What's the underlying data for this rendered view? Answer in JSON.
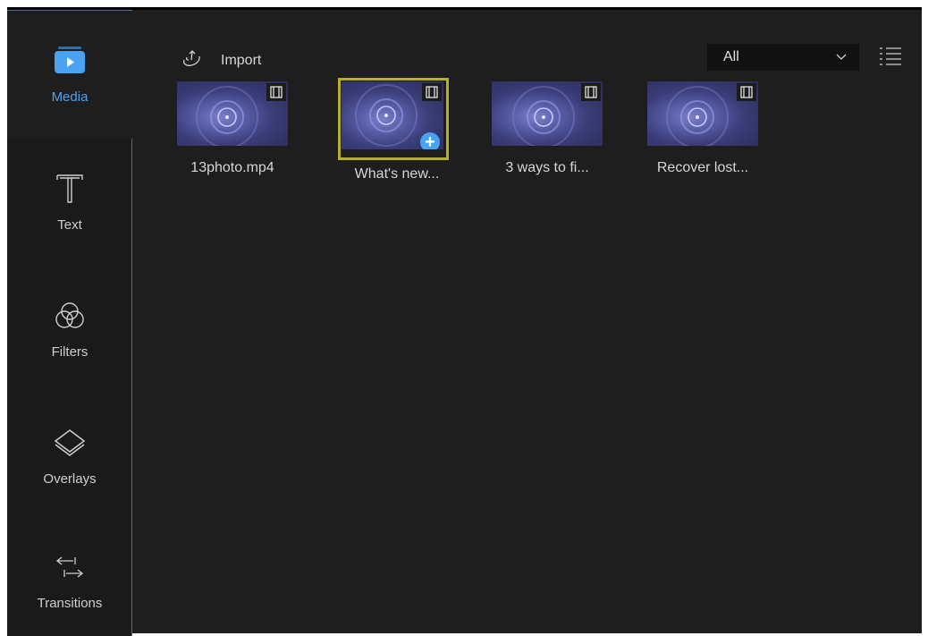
{
  "sidebar": {
    "items": [
      {
        "label": "Media",
        "icon": "play-media-icon"
      },
      {
        "label": "Text",
        "icon": "text-t-icon"
      },
      {
        "label": "Filters",
        "icon": "filters-circles-icon"
      },
      {
        "label": "Overlays",
        "icon": "overlays-layers-icon"
      },
      {
        "label": "Transitions",
        "icon": "transitions-arrows-icon"
      }
    ]
  },
  "toolbar": {
    "import_label": "Import",
    "filter_value": "All"
  },
  "media": {
    "items": [
      {
        "label": "13photo.mp4"
      },
      {
        "label": "What's new..."
      },
      {
        "label": "3 ways to fi..."
      },
      {
        "label": "Recover lost..."
      }
    ]
  },
  "colors": {
    "accent": "#4aa3f0",
    "selection": "#b7ae2a",
    "background": "#1e1e1e"
  }
}
